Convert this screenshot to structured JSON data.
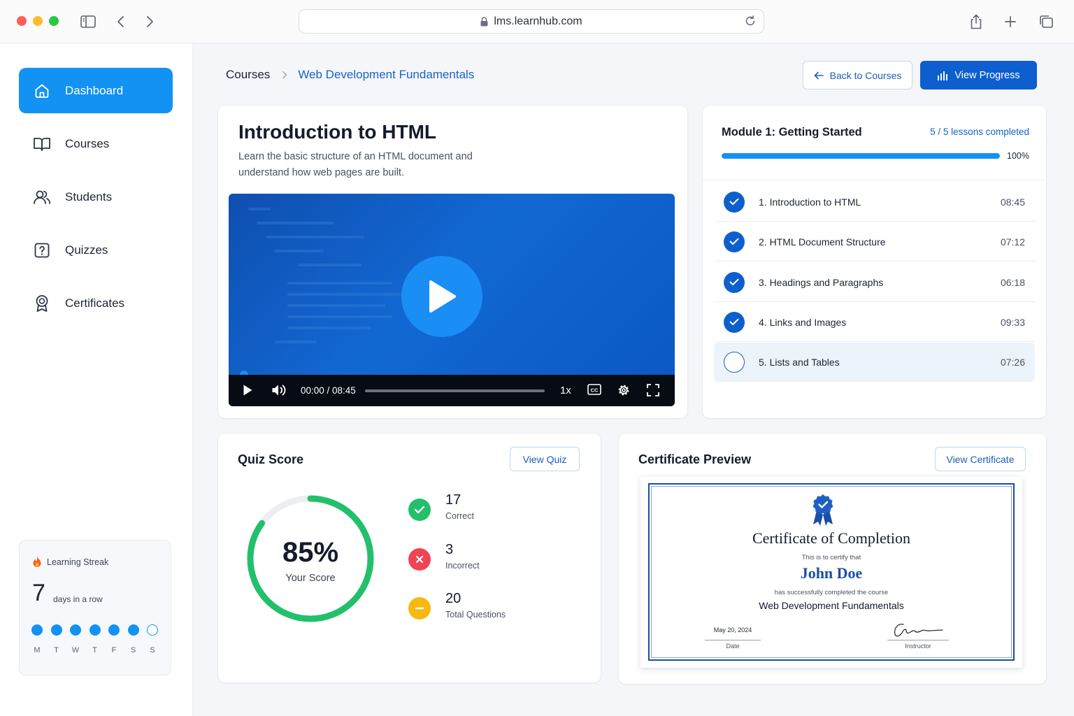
{
  "browser": {
    "url": "lms.learnhub.com"
  },
  "sidebar": {
    "items": [
      {
        "label": "Dashboard",
        "icon": "home-icon",
        "active": true
      },
      {
        "label": "Courses",
        "icon": "book-icon"
      },
      {
        "label": "Students",
        "icon": "users-icon"
      },
      {
        "label": "Quizzes",
        "icon": "question-icon"
      },
      {
        "label": "Certificates",
        "icon": "award-icon"
      }
    ],
    "streak": {
      "title": "Learning Streak",
      "count": "7",
      "subtitle": "days in a row",
      "days": [
        "M",
        "T",
        "W",
        "T",
        "F",
        "S",
        "S"
      ],
      "completed": [
        true,
        true,
        true,
        true,
        true,
        true,
        false
      ]
    }
  },
  "header": {
    "breadcrumb_root": "Courses",
    "breadcrumb_current": "Web Development Fundamentals",
    "back_label": "Back to Courses",
    "progress_label": "View Progress"
  },
  "lesson": {
    "title": "Introduction to HTML",
    "description": "Learn the basic structure of an HTML document and understand how web pages are built.",
    "video": {
      "time": "00:00 / 08:45",
      "speed": "1x",
      "cc_label": "CC"
    }
  },
  "module": {
    "title": "Module 1: Getting Started",
    "count": "5 / 5 lessons completed",
    "percent_label": "100%",
    "percent": 100,
    "lessons": [
      {
        "name": "1. Introduction to HTML",
        "duration": "08:45",
        "done": true
      },
      {
        "name": "2. HTML Document Structure",
        "duration": "07:12",
        "done": true
      },
      {
        "name": "3. Headings and Paragraphs",
        "duration": "06:18",
        "done": true
      },
      {
        "name": "4. Links and Images",
        "duration": "09:33",
        "done": true
      },
      {
        "name": "5. Lists and Tables",
        "duration": "07:26",
        "done": false
      }
    ]
  },
  "quiz": {
    "title": "Quiz Score",
    "view_label": "View Quiz",
    "score_label": "85%",
    "score": 85,
    "score_caption": "Your Score",
    "stats": [
      {
        "value": "17",
        "label": "Correct",
        "color": "#22c06b"
      },
      {
        "value": "3",
        "label": "Incorrect",
        "color": "#ef4452"
      },
      {
        "value": "20",
        "label": "Total Questions",
        "color": "#f8b812"
      }
    ]
  },
  "certificate": {
    "title": "Certificate Preview",
    "view_label": "View Certificate",
    "heading": "Certificate of Completion",
    "certify": "This is to certify that",
    "name": "John Doe",
    "completed": "has successfully completed the course",
    "course": "Web Development Fundamentals",
    "date": "May 20, 2024",
    "date_label": "Date",
    "instructor_label": "Instructor"
  },
  "colors": {
    "primary": "#1292f2",
    "primary_dark": "#0d5fcf",
    "link": "#1565c8",
    "success": "#22c06b"
  }
}
